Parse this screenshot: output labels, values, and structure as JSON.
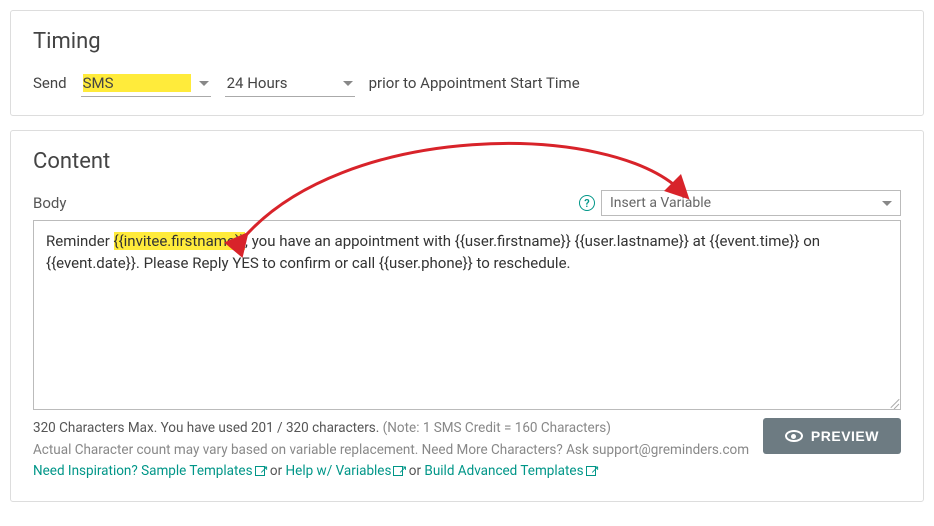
{
  "timing": {
    "heading": "Timing",
    "send_label": "Send",
    "channel_value": "SMS",
    "interval_value": "24 Hours",
    "suffix": "prior to Appointment Start Time"
  },
  "content": {
    "heading": "Content",
    "body_label": "Body",
    "help_icon": "?",
    "variable_placeholder": "Insert a Variable",
    "body_text_prefix": "Reminder ",
    "body_text_highlight": "{{invitee.firstname}}",
    "body_text_suffix": ", you have an appointment with {{user.firstname}} {{user.lastname}} at {{event.time}} on {{event.date}}.  Please Reply YES to confirm or call {{user.phone}} to reschedule.",
    "char_counter": "320 Characters Max. You have used 201 / 320 characters.",
    "char_note": " (Note: 1 SMS Credit = 160 Characters)",
    "replacement_note": "Actual Character count may vary based on variable replacement. Need More Characters? Ask support@greminders.com",
    "inspiration_link": "Need Inspiration? Sample Templates",
    "or_sep": " or ",
    "help_link": "Help w/ Variables",
    "or_sep2": " or ",
    "advanced_link": "Build Advanced Templates",
    "preview_btn": "PREVIEW"
  }
}
